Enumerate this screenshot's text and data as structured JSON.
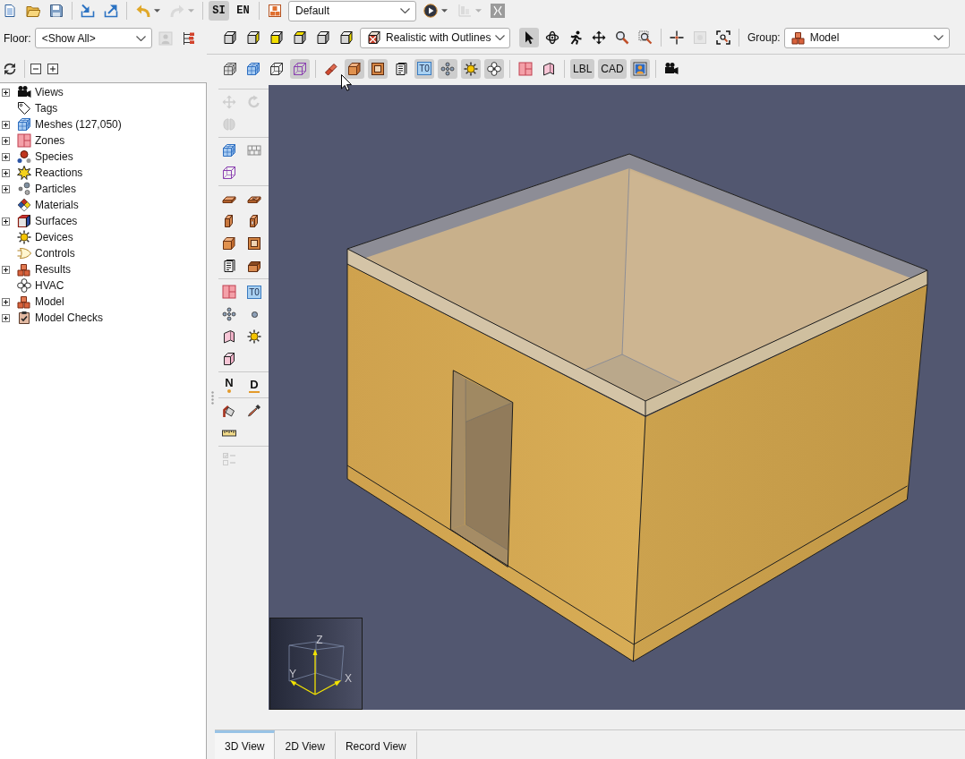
{
  "main_toolbar": [
    {
      "kind": "icon",
      "disabled": false
    },
    {
      "kind": "icon",
      "disabled": false
    },
    {
      "kind": "icon",
      "disabled": false
    },
    {
      "kind": "separator"
    },
    {
      "kind": "icon",
      "disabled": false
    },
    {
      "kind": "icon",
      "disabled": false
    },
    {
      "kind": "separator"
    },
    {
      "kind": "split",
      "disabled": false
    },
    {
      "kind": "split",
      "disabled": true
    },
    {
      "kind": "separator"
    },
    {
      "kind": "text",
      "label": "SI",
      "selected": true
    },
    {
      "kind": "text",
      "label": "EN",
      "selected": false
    },
    {
      "kind": "separator"
    },
    {
      "kind": "icon",
      "disabled": false
    },
    {
      "kind": "dropdown",
      "value": "Default"
    },
    {
      "kind": "split",
      "disabled": false
    },
    {
      "kind": "split",
      "disabled": true
    },
    {
      "kind": "icon",
      "disabled": false
    }
  ],
  "floor": {
    "label": "Floor:",
    "value": "<Show All>",
    "buttons": [
      {
        "disabled": true
      },
      {
        "disabled": false
      }
    ]
  },
  "view_toolbar": [
    {
      "kind": "icon",
      "selected": false,
      "disabled": false
    },
    {
      "kind": "icon",
      "selected": false,
      "disabled": false
    },
    {
      "kind": "icon",
      "selected": false,
      "disabled": false
    },
    {
      "kind": "icon",
      "selected": false,
      "disabled": false
    },
    {
      "kind": "icon",
      "selected": false,
      "disabled": false
    },
    {
      "kind": "icon",
      "selected": false,
      "disabled": false
    },
    {
      "kind": "dropdown",
      "value": "Realistic with Outlines"
    },
    {
      "kind": "icon",
      "selected": true,
      "disabled": false
    },
    {
      "kind": "icon",
      "selected": false,
      "disabled": false
    },
    {
      "kind": "icon",
      "selected": false,
      "disabled": false
    },
    {
      "kind": "icon",
      "selected": false,
      "disabled": false
    },
    {
      "kind": "icon",
      "selected": false,
      "disabled": false
    },
    {
      "kind": "icon",
      "selected": false,
      "disabled": false
    },
    {
      "kind": "separator"
    },
    {
      "kind": "icon",
      "selected": false,
      "disabled": false
    },
    {
      "kind": "icon",
      "selected": false,
      "disabled": true
    },
    {
      "kind": "icon",
      "selected": false,
      "disabled": false
    },
    {
      "kind": "separator"
    },
    {
      "kind": "label",
      "text": "Group:"
    },
    {
      "kind": "dropdown",
      "value": "Model"
    }
  ],
  "display_toolbar": [
    {
      "kind": "icon",
      "selected": false
    },
    {
      "kind": "icon",
      "selected": false
    },
    {
      "kind": "icon",
      "selected": false
    },
    {
      "kind": "icon",
      "selected": true
    },
    {
      "kind": "separator"
    },
    {
      "kind": "icon",
      "selected": false
    },
    {
      "kind": "icon",
      "selected": true
    },
    {
      "kind": "icon",
      "selected": true
    },
    {
      "kind": "icon",
      "selected": false
    },
    {
      "kind": "tag",
      "label": "T0",
      "selected": true
    },
    {
      "kind": "icon",
      "selected": true
    },
    {
      "kind": "icon",
      "selected": true
    },
    {
      "kind": "icon",
      "selected": true
    },
    {
      "kind": "separator"
    },
    {
      "kind": "icon",
      "selected": false
    },
    {
      "kind": "icon",
      "selected": false
    },
    {
      "kind": "separator"
    },
    {
      "kind": "text",
      "label": "LBL",
      "selected": true
    },
    {
      "kind": "text",
      "label": "CAD",
      "selected": true
    },
    {
      "kind": "icon",
      "selected": true
    },
    {
      "kind": "separator"
    },
    {
      "kind": "icon",
      "selected": false
    }
  ],
  "side_toolbar": [
    [
      {
        "kind": "icon",
        "disabled": true
      },
      {
        "kind": "icon",
        "disabled": true
      },
      {
        "kind": "icon",
        "disabled": true
      }
    ],
    [
      {
        "kind": "icon",
        "disabled": false
      },
      {
        "kind": "icon",
        "disabled": false
      },
      {
        "kind": "icon",
        "disabled": false
      }
    ],
    [
      {
        "kind": "icon",
        "disabled": false
      },
      {
        "kind": "icon",
        "disabled": false
      },
      {
        "kind": "icon",
        "disabled": false
      },
      {
        "kind": "icon",
        "disabled": false
      },
      {
        "kind": "icon",
        "disabled": false
      },
      {
        "kind": "icon",
        "disabled": false
      },
      {
        "kind": "icon",
        "disabled": false
      },
      {
        "kind": "icon",
        "disabled": false
      }
    ],
    [
      {
        "kind": "icon",
        "disabled": false
      },
      {
        "kind": "tag",
        "label": "T0",
        "disabled": false
      },
      {
        "kind": "icon",
        "disabled": false
      },
      {
        "kind": "icon",
        "disabled": false
      },
      {
        "kind": "icon",
        "disabled": false
      },
      {
        "kind": "icon",
        "disabled": false
      },
      {
        "kind": "icon",
        "disabled": false
      }
    ],
    [
      {
        "kind": "dotted",
        "label": "N",
        "disabled": false
      },
      {
        "kind": "underlined",
        "label": "D",
        "disabled": false
      }
    ],
    [
      {
        "kind": "icon",
        "disabled": false
      },
      {
        "kind": "icon",
        "disabled": false
      },
      {
        "kind": "icon",
        "disabled": false
      }
    ],
    [
      {
        "kind": "icon",
        "disabled": true
      }
    ]
  ],
  "model_tree": [
    {
      "label": "Views",
      "kind": "branch",
      "expanded": false
    },
    {
      "label": "Tags",
      "kind": "leaf"
    },
    {
      "label": "Meshes (127,050)",
      "kind": "branch",
      "expanded": false
    },
    {
      "label": "Zones",
      "kind": "branch",
      "expanded": false
    },
    {
      "label": "Species",
      "kind": "branch",
      "expanded": false
    },
    {
      "label": "Reactions",
      "kind": "branch",
      "expanded": false
    },
    {
      "label": "Particles",
      "kind": "branch",
      "expanded": false
    },
    {
      "label": "Materials",
      "kind": "leaf"
    },
    {
      "label": "Surfaces",
      "kind": "branch",
      "expanded": false
    },
    {
      "label": "Devices",
      "kind": "leaf"
    },
    {
      "label": "Controls",
      "kind": "leaf"
    },
    {
      "label": "Results",
      "kind": "branch",
      "expanded": false
    },
    {
      "label": "HVAC",
      "kind": "leaf"
    },
    {
      "label": "Model",
      "kind": "branch",
      "expanded": false
    },
    {
      "label": "Model Checks",
      "kind": "branch",
      "expanded": false
    }
  ],
  "viewport": {
    "axes": {
      "z": "Z",
      "y": "Y",
      "x": "X"
    }
  },
  "view_tabs": [
    {
      "label": "3D View",
      "selected": true
    },
    {
      "label": "2D View",
      "selected": false
    },
    {
      "label": "Record View",
      "selected": false
    }
  ]
}
